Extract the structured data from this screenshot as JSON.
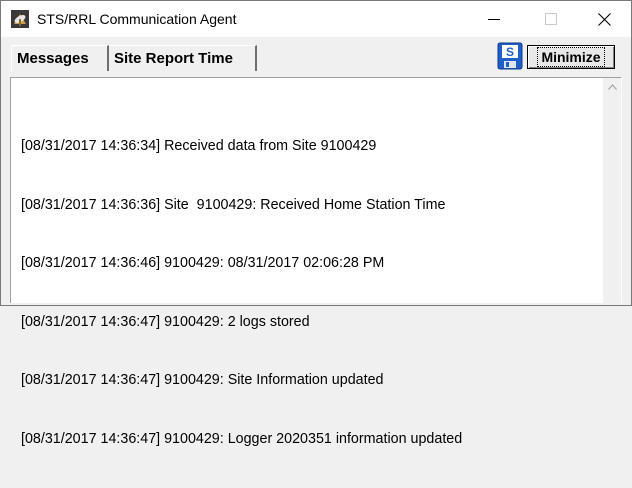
{
  "window": {
    "title": "STS/RRL Communication Agent",
    "icon": "satellite-dish-icon"
  },
  "title_buttons": {
    "minimize_icon": "minimize-icon",
    "maximize_icon": "maximize-icon",
    "close_icon": "close-icon"
  },
  "tabs": [
    {
      "label": "Messages",
      "active": true
    },
    {
      "label": "Site Report Time",
      "active": false
    }
  ],
  "toolbar": {
    "s_icon_letter": "S",
    "minimize_label": "Minimize"
  },
  "messages": [
    "[08/31/2017 14:36:34] Received data from Site 9100429",
    "[08/31/2017 14:36:36] Site  9100429: Received Home Station Time",
    "[08/31/2017 14:36:46] 9100429: 08/31/2017 02:06:28 PM",
    "[08/31/2017 14:36:47] 9100429: 2 logs stored",
    "[08/31/2017 14:36:47] 9100429: Site Information updated",
    "[08/31/2017 14:36:47] 9100429: Logger 2020351 information updated"
  ],
  "colors": {
    "titlebar_bg": "#ffffff",
    "window_bg": "#f0f0f0",
    "panel_bg": "#ffffff",
    "s_icon_blue": "#1f5fc8"
  }
}
